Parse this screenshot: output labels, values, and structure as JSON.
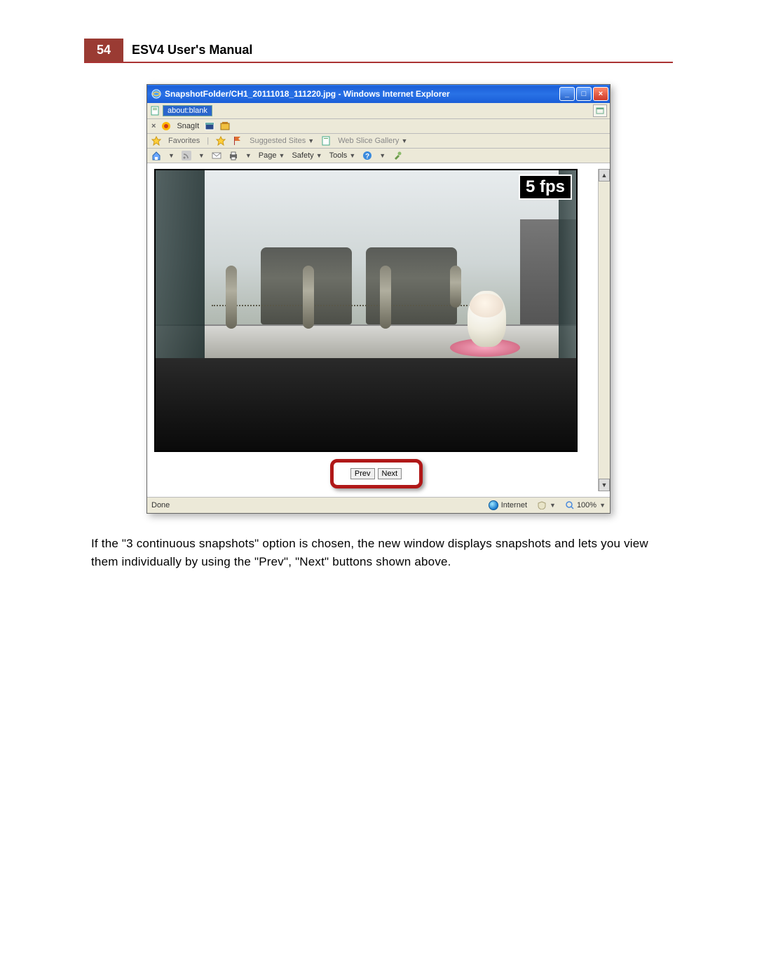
{
  "header": {
    "page_number": "54",
    "title": "ESV4 User's Manual"
  },
  "window": {
    "title": "SnapshotFolder/CH1_20111018_111220.jpg - Windows Internet Explorer",
    "controls": {
      "minimize": "_",
      "maximize": "□",
      "close": "×"
    }
  },
  "address_bar": {
    "url": "about:blank"
  },
  "snagit_bar": {
    "close": "×",
    "label": "SnagIt"
  },
  "favorites_bar": {
    "label": "Favorites",
    "suggested": "Suggested Sites",
    "webslice": "Web Slice Gallery"
  },
  "command_bar": {
    "page": "Page",
    "safety": "Safety",
    "tools": "Tools"
  },
  "snapshot": {
    "fps_label": "5 fps",
    "prev": "Prev",
    "next": "Next"
  },
  "status_bar": {
    "done": "Done",
    "zone": "Internet",
    "zoom": "100%"
  },
  "caption": "If the \"3 continuous snapshots\" option is chosen, the new window displays snapshots and lets you view them individually by using the \"Prev\", \"Next\" buttons shown above."
}
